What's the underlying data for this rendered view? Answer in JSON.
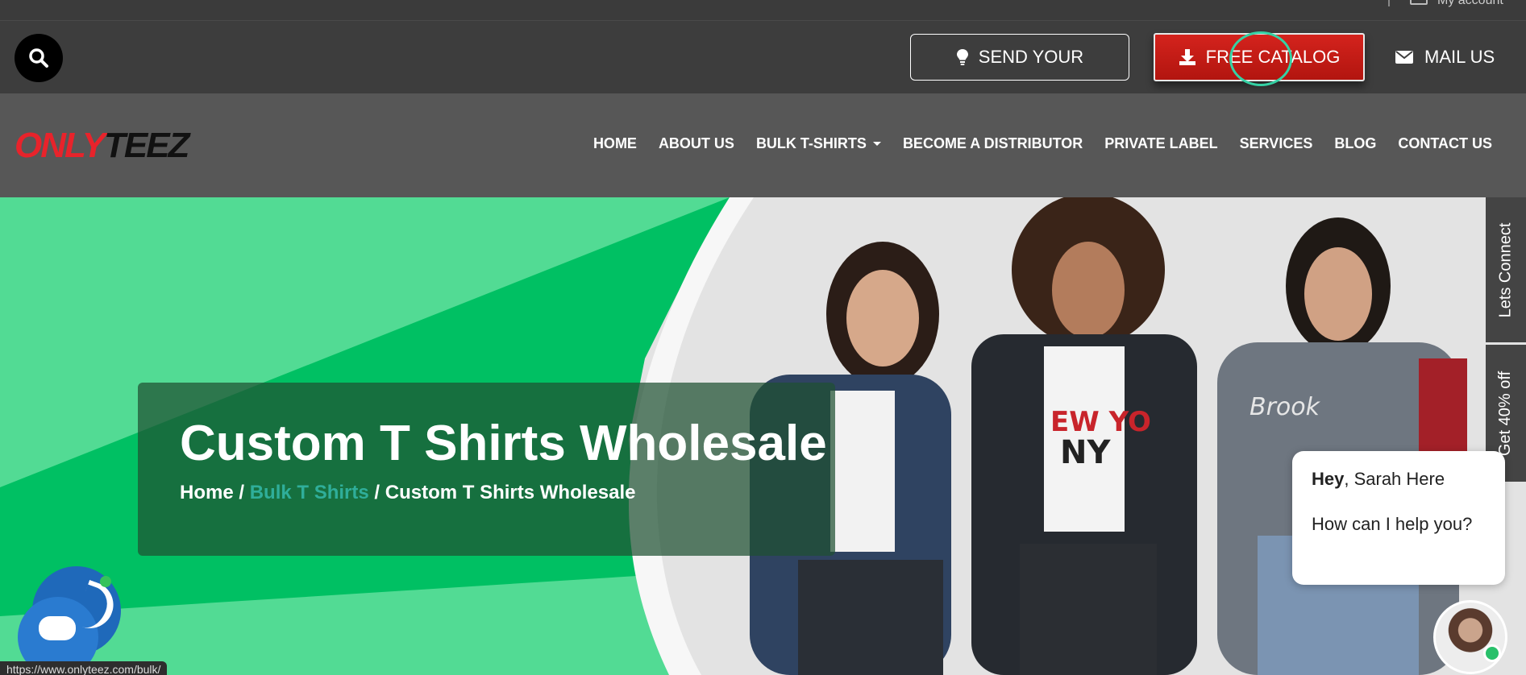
{
  "topstrip": {
    "text": "My account"
  },
  "actions": {
    "send_label": "SEND YOUR",
    "catalog_label": "FREE CATALOG",
    "mail_label": "MAIL US",
    "accent_red": "#c81b16",
    "accent_teal": "#35d1a4"
  },
  "logo": {
    "part1": "ONLY",
    "part2": "TEEZ"
  },
  "nav": {
    "items": [
      {
        "label": "HOME"
      },
      {
        "label": "ABOUT US"
      },
      {
        "label": "BULK T-SHIRTS"
      },
      {
        "label": "BECOME A DISTRIBUTOR"
      },
      {
        "label": "PRIVATE LABEL"
      },
      {
        "label": "SERVICES"
      },
      {
        "label": "BLOG"
      },
      {
        "label": "CONTACT US"
      }
    ]
  },
  "hero": {
    "title": "Custom T Shirts Wholesale",
    "breadcrumb": {
      "home": "Home",
      "sep": " / ",
      "parent": "Bulk T Shirts",
      "current": "Custom T Shirts Wholesale"
    },
    "green": "#00c063"
  },
  "side_tabs": {
    "connect": "Lets Connect",
    "offer": "Get 40% off"
  },
  "chat": {
    "greeting_bold": "Hey",
    "greeting_rest": ", Sarah Here",
    "question": "How can I help you?"
  },
  "status_bar": {
    "url": "https://www.onlyteez.com/bulk/"
  }
}
